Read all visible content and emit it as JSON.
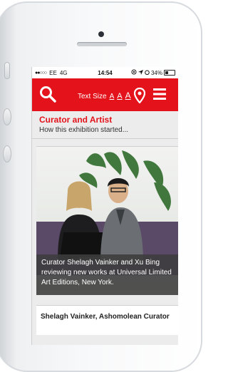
{
  "status_bar": {
    "signal": "●●○○○",
    "carrier": "EE",
    "network": "4G",
    "time": "14:54",
    "battery_percent": "34%",
    "battery_level": 0.34
  },
  "app_bar": {
    "text_size_label": "Text Size",
    "size_options": [
      "A",
      "A",
      "A"
    ],
    "accent_color": "#e3121b"
  },
  "section": {
    "title": "Curator and Artist",
    "subtitle": "How this exhibition started..."
  },
  "media_card": {
    "caption": "Curator Shelagh Vainker and Xu Bing reviewing new works at Universal Limited Art Editions, New York."
  },
  "next_card": {
    "title": "Shelagh Vainker, Ashomolean Curator"
  }
}
